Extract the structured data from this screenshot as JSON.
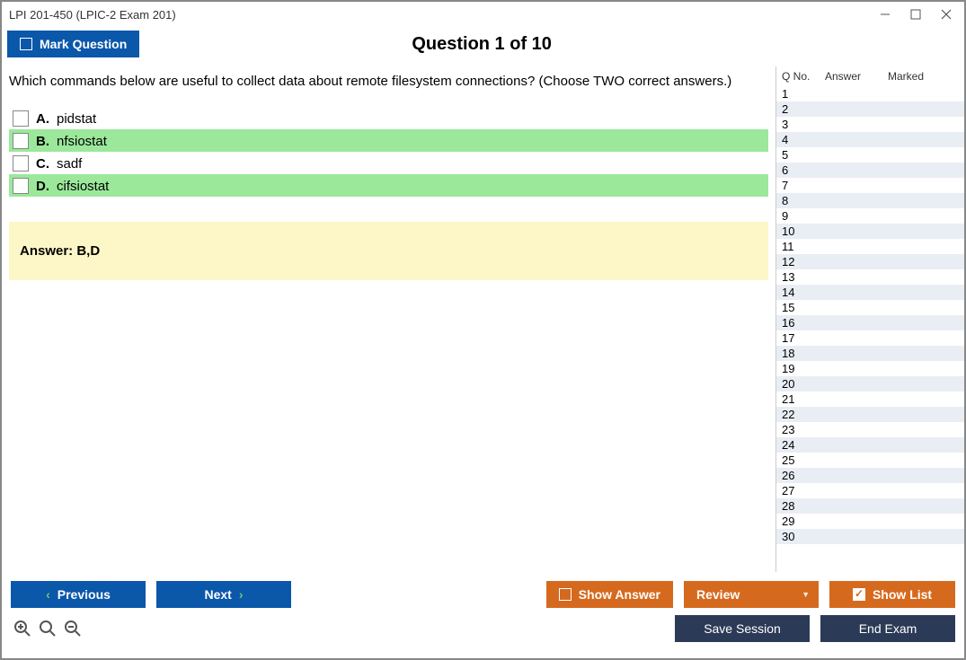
{
  "window": {
    "title": "LPI 201-450 (LPIC-2 Exam 201)"
  },
  "header": {
    "mark_label": "Mark Question",
    "question_label": "Question 1 of 10"
  },
  "question": {
    "text": "Which commands below are useful to collect data about remote filesystem connections? (Choose TWO correct answers.)",
    "options": [
      {
        "letter": "A.",
        "text": "pidstat",
        "correct": false
      },
      {
        "letter": "B.",
        "text": "nfsiostat",
        "correct": true
      },
      {
        "letter": "C.",
        "text": "sadf",
        "correct": false
      },
      {
        "letter": "D.",
        "text": "cifsiostat",
        "correct": true
      }
    ],
    "answer_label": "Answer: B,D"
  },
  "sidebar": {
    "headers": {
      "qno": "Q No.",
      "answer": "Answer",
      "marked": "Marked"
    },
    "rows": [
      "1",
      "2",
      "3",
      "4",
      "5",
      "6",
      "7",
      "8",
      "9",
      "10",
      "11",
      "12",
      "13",
      "14",
      "15",
      "16",
      "17",
      "18",
      "19",
      "20",
      "21",
      "22",
      "23",
      "24",
      "25",
      "26",
      "27",
      "28",
      "29",
      "30"
    ]
  },
  "buttons": {
    "previous": "Previous",
    "next": "Next",
    "show_answer": "Show Answer",
    "review": "Review",
    "show_list": "Show List",
    "save_session": "Save Session",
    "end_exam": "End Exam"
  }
}
